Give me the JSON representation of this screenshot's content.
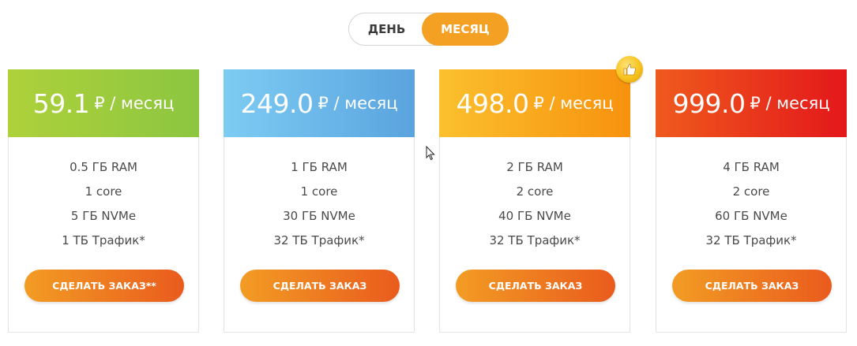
{
  "period_toggle": {
    "options": [
      "ДЕНЬ",
      "МЕСЯЦ"
    ],
    "selected": "МЕСЯЦ"
  },
  "plans": [
    {
      "price": "59.1",
      "unit": "₽ / месяц",
      "specs": [
        "0.5 ГБ RAM",
        "1 core",
        "5 ГБ NVMe",
        "1 ТБ Трафик*"
      ],
      "button": "СДЕЛАТЬ ЗАКАЗ**"
    },
    {
      "price": "249.0",
      "unit": "₽ / месяц",
      "specs": [
        "1 ГБ RAM",
        "1 core",
        "30 ГБ NVMe",
        "32 ТБ Трафик*"
      ],
      "button": "СДЕЛАТЬ ЗАКАЗ"
    },
    {
      "price": "498.0",
      "unit": "₽ / месяц",
      "specs": [
        "2 ГБ RAM",
        "2 core",
        "40 ГБ NVMe",
        "32 ТБ Трафик*"
      ],
      "button": "СДЕЛАТЬ ЗАКАЗ"
    },
    {
      "price": "999.0",
      "unit": "₽ / месяц",
      "specs": [
        "4 ГБ RAM",
        "2 core",
        "60 ГБ NVMe",
        "32 ТБ Трафик*"
      ],
      "button": "СДЕЛАТЬ ЗАКАЗ"
    }
  ],
  "colors": {
    "toggle_active": "#f3a023",
    "plan_1_head": "#9bcd3d",
    "plan_2_head": "#6bb8ea",
    "plan_3_head": "#f9a91d",
    "plan_4_head": "#e9381c",
    "button": "#ef7a20"
  },
  "badge_icon": "thumbs-up-icon"
}
